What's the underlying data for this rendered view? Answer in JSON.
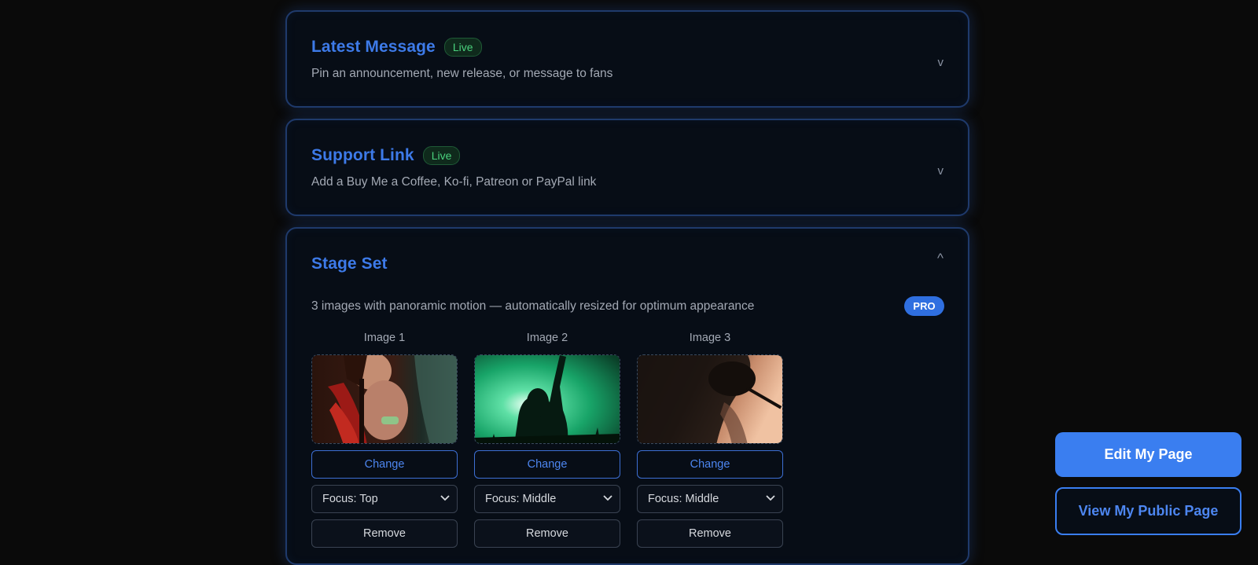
{
  "sections": {
    "latest_message": {
      "title": "Latest Message",
      "badge": "Live",
      "description": "Pin an announcement, new release, or message to fans",
      "toggle": "v"
    },
    "support_link": {
      "title": "Support Link",
      "badge": "Live",
      "description": "Add a Buy Me a Coffee, Ko-fi, Patreon or PayPal link",
      "toggle": "v"
    },
    "stage_set": {
      "title": "Stage Set",
      "toggle": "^",
      "description": "3 images with panoramic motion — automatically resized for optimum appearance",
      "badge": "PRO",
      "images": [
        {
          "label": "Image 1",
          "change_label": "Change",
          "focus": "Focus: Top",
          "remove_label": "Remove",
          "alt": "violinist-photo"
        },
        {
          "label": "Image 2",
          "change_label": "Change",
          "focus": "Focus: Middle",
          "remove_label": "Remove",
          "alt": "guitarist-green-stage-photo"
        },
        {
          "label": "Image 3",
          "change_label": "Change",
          "focus": "Focus: Middle",
          "remove_label": "Remove",
          "alt": "singer-silhouette-photo"
        }
      ]
    }
  },
  "actions": {
    "edit_label": "Edit My Page",
    "view_label": "View My Public Page"
  },
  "colors": {
    "accent": "#3a7ef0",
    "live_green": "#4ad27d",
    "background": "#0a0a0a",
    "card": "#070d16"
  }
}
